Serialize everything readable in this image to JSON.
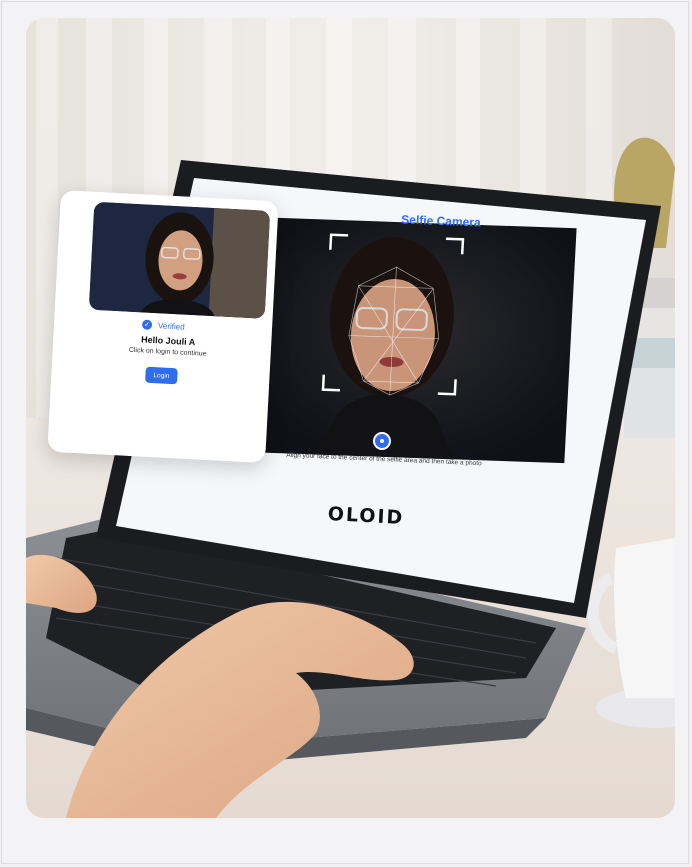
{
  "laptop_screen": {
    "title": "Selfie Camera",
    "caption": "Align your face to the center of the selfie area and then take a photo",
    "brand": "OLOID"
  },
  "verify_card": {
    "status": "Verified",
    "greeting": "Hello Jouli A",
    "instruction": "Click on login to continue",
    "login_label": "Login"
  },
  "colors": {
    "accent": "#2f6df0",
    "card_bg": "#ffffff",
    "page_bg": "#f1f1f3"
  },
  "icons": [
    "check-icon",
    "capture-button-icon",
    "cursor-icon"
  ]
}
